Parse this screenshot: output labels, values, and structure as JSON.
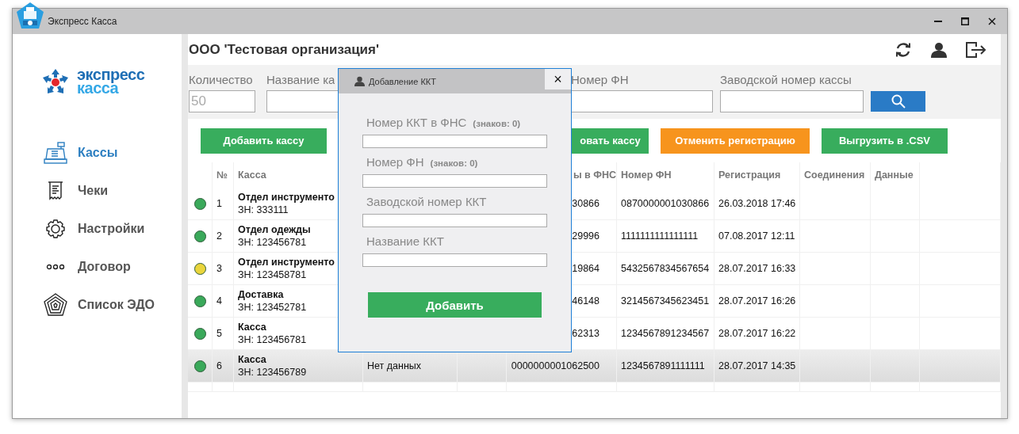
{
  "window": {
    "title": "Экспресс Касса"
  },
  "logo": {
    "line1": "экспресс",
    "line2": "касса"
  },
  "sidebar": {
    "items": [
      {
        "label": "Кассы",
        "kind": "register",
        "selected": true
      },
      {
        "label": "Чеки",
        "kind": "receipt",
        "selected": false
      },
      {
        "label": "Настройки",
        "kind": "gear",
        "selected": false
      },
      {
        "label": "Договор",
        "kind": "dots",
        "selected": false
      },
      {
        "label": "Список ЭДО",
        "kind": "pentagon",
        "selected": false
      }
    ]
  },
  "header": {
    "organization": "ООО 'Тестовая организация'"
  },
  "filters": [
    {
      "label": "Количество",
      "placeholder": "50"
    },
    {
      "label": "Название ка"
    },
    {
      "label": "Номер ФН"
    },
    {
      "label": "Заводской номер кассы"
    }
  ],
  "toolbar": {
    "buttons": [
      {
        "label": "Добавить кассу",
        "color": "#38ad5d"
      },
      {
        "label": "овать кассу",
        "color": "#38ad5d"
      },
      {
        "label": "Отменить регистрацию",
        "color": "#f7941d"
      },
      {
        "label": "Выгрузить в .CSV",
        "color": "#38ad5d"
      }
    ]
  },
  "table": {
    "columns": {
      "number": "№",
      "name": "Касса",
      "kkt_fns": "ы в ФНС",
      "fn": "Номер ФН",
      "registered": "Регистрация",
      "connections": "Соединения",
      "data": "Данные"
    },
    "rows": [
      {
        "color": "#3aa95a",
        "selected": false,
        "number": "1",
        "name": "Отдел инструменто",
        "serial": "ЗН: 333111",
        "kkt_fns": "30866",
        "fn": "0870000001030866",
        "registered": "26.03.2018 17:46"
      },
      {
        "color": "#3aa95a",
        "selected": false,
        "number": "2",
        "name": "Отдел одежды",
        "serial": "ЗН: 123456781",
        "kkt_fns": "29996",
        "fn": "1111111111111111",
        "registered": "07.08.2017 12:11"
      },
      {
        "color": "#ead53c",
        "selected": false,
        "number": "3",
        "name": "Отдел инструменто",
        "serial": "ЗН: 123458781",
        "kkt_fns": "19864",
        "fn": "5432567834567654",
        "registered": "28.07.2017 16:33"
      },
      {
        "color": "#3aa95a",
        "selected": false,
        "number": "4",
        "name": "Доставка",
        "serial": "ЗН: 123452781",
        "kkt_fns": "46148",
        "fn": "3214567345623451",
        "registered": "28.07.2017 16:26"
      },
      {
        "color": "#3aa95a",
        "selected": false,
        "number": "5",
        "name": "Касса",
        "serial": "ЗН: 123456781",
        "kkt_fns": "62313",
        "fn": "1234567891234567",
        "registered": "28.07.2017 16:22"
      },
      {
        "color": "#3aa95a",
        "selected": true,
        "number": "6",
        "name": "Касса",
        "serial": "ЗН: 123456789",
        "column_4": "Нет данных",
        "kkt_fns": "0000000001062500",
        "fn": "1234567891111111",
        "registered": "28.07.2017 14:35"
      }
    ]
  },
  "dialog": {
    "title": "Добавление ККТ",
    "close": "×",
    "fields": [
      {
        "label": "Номер ККТ в ФНС",
        "counter": "(знаков: 0)"
      },
      {
        "label": "Номер ФН",
        "counter": "(знаков: 0)"
      },
      {
        "label": "Заводской номер ККТ"
      },
      {
        "label": "Название ККТ"
      }
    ],
    "submit": "Добавить"
  }
}
